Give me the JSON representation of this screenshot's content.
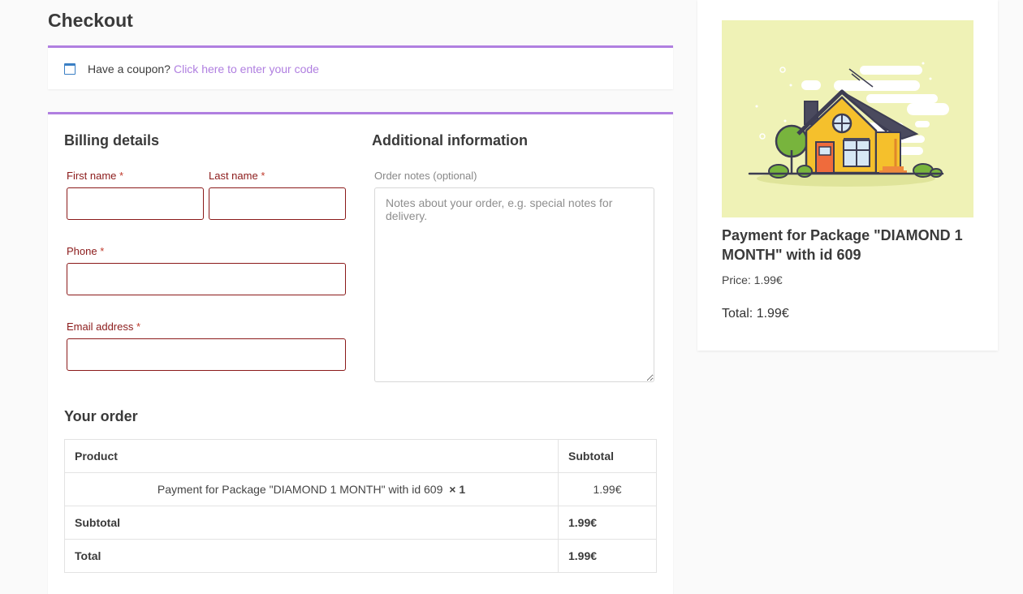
{
  "page": {
    "title": "Checkout"
  },
  "coupon": {
    "prompt": "Have a coupon?",
    "link": "Click here to enter your code"
  },
  "billing": {
    "title": "Billing details",
    "first_name": {
      "label": "First name",
      "required": "*",
      "value": ""
    },
    "last_name": {
      "label": "Last name",
      "required": "*",
      "value": ""
    },
    "phone": {
      "label": "Phone",
      "required": "*",
      "value": ""
    },
    "email": {
      "label": "Email address",
      "required": "*",
      "value": ""
    }
  },
  "additional": {
    "title": "Additional information",
    "notes_label": "Order notes (optional)",
    "notes_placeholder": "Notes about your order, e.g. special notes for delivery.",
    "notes_value": ""
  },
  "order": {
    "title": "Your order",
    "headers": {
      "product": "Product",
      "subtotal": "Subtotal"
    },
    "item": {
      "name": "Payment for Package \"DIAMOND 1 MONTH\" with id 609",
      "qty": "× 1",
      "subtotal": "1.99€"
    },
    "subtotal": {
      "label": "Subtotal",
      "value": "1.99€"
    },
    "total": {
      "label": "Total",
      "value": "1.99€"
    }
  },
  "sidebar": {
    "image_icon": "house-illustration",
    "product_title": "Payment for Package \"DIAMOND 1 MONTH\" with id 609",
    "price": "Price: 1.99€",
    "total": "Total: 1.99€"
  },
  "colors": {
    "accent": "#b07fe0",
    "required_border": "#8b1a1a",
    "image_bg": "#eff2b6",
    "house": "#f5c02c"
  }
}
